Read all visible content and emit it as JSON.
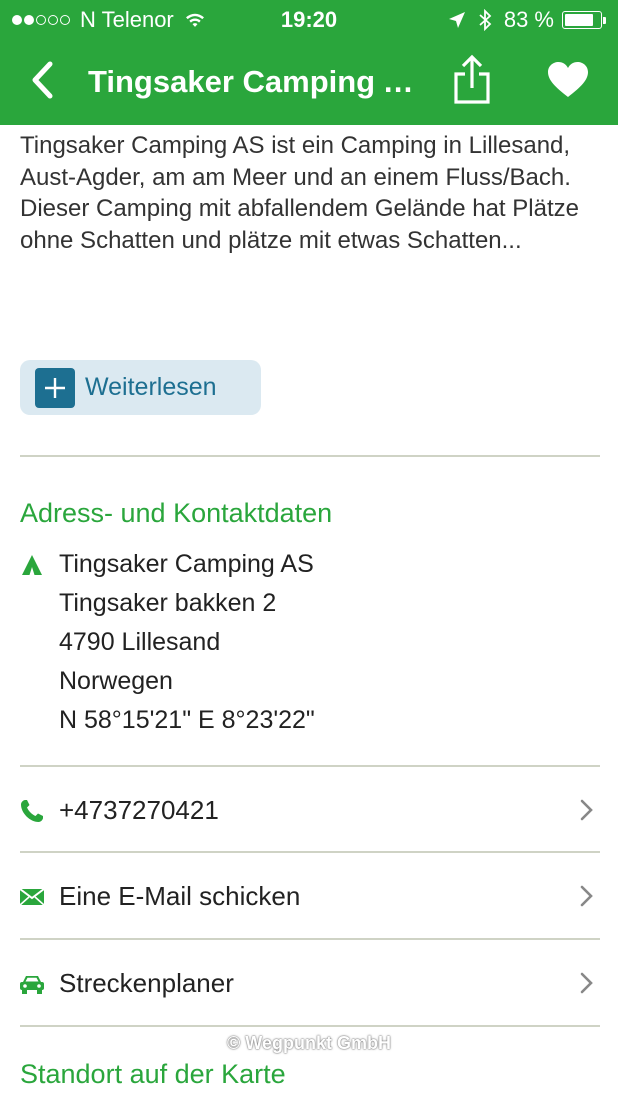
{
  "status_bar": {
    "carrier": "N Telenor",
    "time": "19:20",
    "battery_percent_text": "83 %",
    "battery_level": 0.83,
    "signal_dots_filled": 2,
    "signal_dots_total": 5
  },
  "nav": {
    "title": "Tingsaker Camping AS",
    "back_icon": "chevron-left-icon",
    "share_icon": "share-icon",
    "favorite_icon": "heart-icon"
  },
  "description": "Tingsaker Camping AS ist ein Camping in Lillesand, Aust-Agder, am am Meer und an einem Fluss/Bach. Dieser Camping mit abfallendem Gelände hat Plätze ohne Schatten und plätze mit etwas Schatten...",
  "read_more": {
    "label": "Weiterlesen"
  },
  "contact_section": {
    "title": "Adress- und Kontaktdaten",
    "address_lines": [
      "Tingsaker Camping AS",
      "Tingsaker bakken 2",
      "4790 Lillesand",
      "Norwegen",
      "N 58°15'21\" E 8°23'22\""
    ]
  },
  "actions": [
    {
      "label": "+4737270421",
      "icon": "phone-icon"
    },
    {
      "label": "Eine E-Mail schicken",
      "icon": "mail-icon"
    },
    {
      "label": "Streckenplaner",
      "icon": "car-icon"
    }
  ],
  "watermark": "© Wegpunkt GmbH",
  "map_section": {
    "title": "Standort auf der Karte"
  },
  "colors": {
    "brand_green": "#2aa63c",
    "link_blue": "#1d6f91",
    "button_bg": "#dbe9f1"
  }
}
